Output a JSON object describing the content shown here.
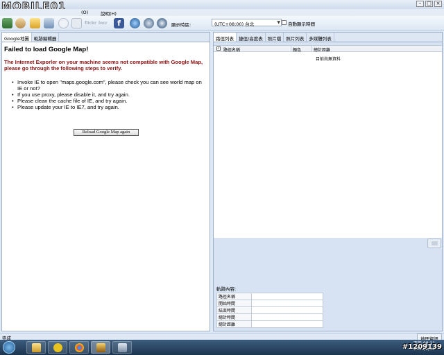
{
  "watermark": {
    "logo": "MOBILE01",
    "id": "#1209139"
  },
  "menu": {
    "items": [
      "(O)",
      "說明(H)"
    ]
  },
  "toolbar": {
    "timezone_label": "顯示時區:",
    "timezone_value": "(UTC+08:00) 台北",
    "auto_tz_label": "自動顯示時間",
    "icons": [
      "gps-device-icon",
      "user-icon",
      "folder-open-icon",
      "export-icon",
      "clock-icon",
      "print-icon",
      "flickr-icon",
      "locr-icon",
      "facebook-icon",
      "google-earth-icon",
      "save-icon",
      "disk-icon"
    ],
    "flickr": "flickr",
    "locr": "locr"
  },
  "left": {
    "tabs": [
      "Google地圖",
      "軌跡編輯器"
    ],
    "error_title": "Failed to load Google Map!",
    "error_message": "The Internet Exporler on your machine seems not compatible with Google Map, please go through the following steps to verify.",
    "steps": [
      "Invoke IE to open \"maps.google.com\", please check you can see world map on IE or not?",
      "If you use proxy, please disable it, and try again.",
      "Please clean the cache file of IE, and try again.",
      "Please update your IE to IE7, and try again."
    ],
    "reload_button": "Reload Google Map again"
  },
  "right": {
    "tabs": [
      "路徑列表",
      "捷徑/高度表",
      "照片檔",
      "照片列表",
      "多媒體列表"
    ],
    "columns": [
      "路徑名稱",
      "顏色",
      "總計距離"
    ],
    "empty_text": "目前尚無資料",
    "track_label": "軌跡內容:",
    "track_rows": [
      "路徑名稱",
      "開始時間",
      "結束時間",
      "總計時間",
      "總計距離"
    ]
  },
  "status": {
    "left": "完成",
    "right": "地理資訊"
  },
  "taskbar": {
    "time": "下午 08:11",
    "date": "2010/2/10"
  }
}
